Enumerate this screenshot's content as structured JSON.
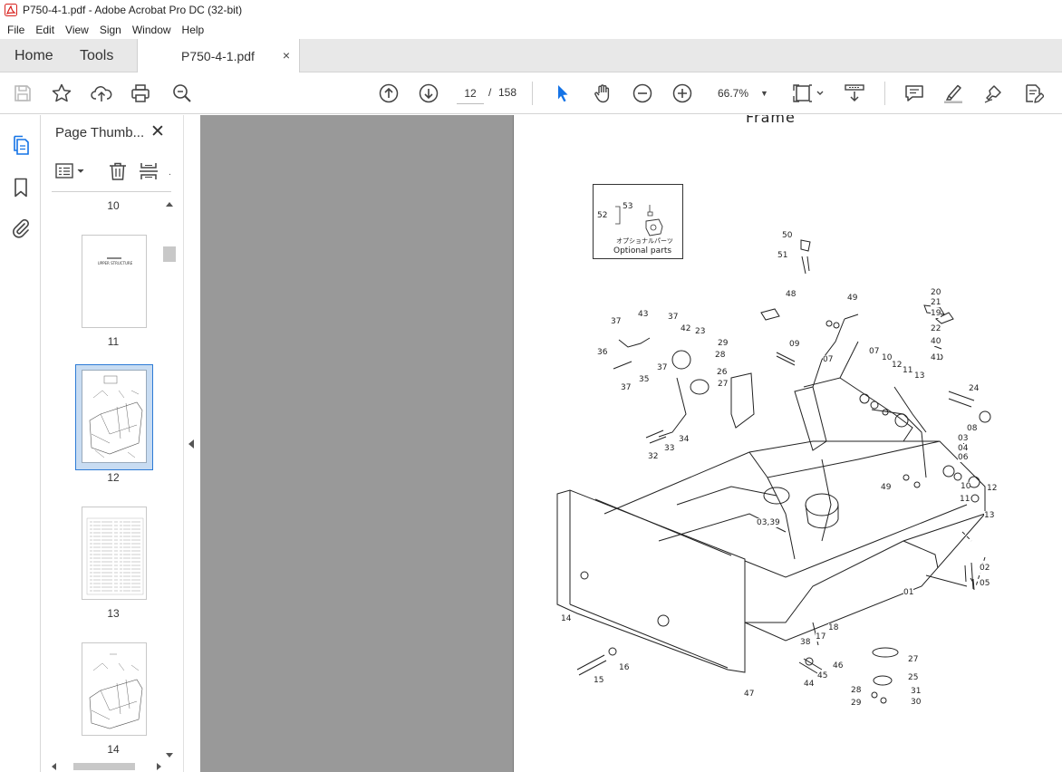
{
  "window": {
    "title": "P750-4-1.pdf - Adobe Acrobat Pro DC (32-bit)"
  },
  "menu": [
    "File",
    "Edit",
    "View",
    "Sign",
    "Window",
    "Help"
  ],
  "tabs": {
    "home": "Home",
    "tools": "Tools",
    "file": "P750-4-1.pdf",
    "close": "×"
  },
  "toolbar": {
    "page_current": "12",
    "page_sep": "/",
    "page_total": "158",
    "zoom": "66.7%",
    "icons": [
      "save-icon",
      "star-icon",
      "upload-icon",
      "print-icon",
      "zoom-search-icon",
      "prev-page-icon",
      "next-page-icon",
      "select-cursor-icon",
      "hand-icon",
      "zoom-out-icon",
      "zoom-in-icon",
      "fit-page-icon",
      "scroll-mode-icon",
      "comment-icon",
      "highlight-icon",
      "sign-icon",
      "edit-pdf-icon"
    ],
    "accent": "#1473e6"
  },
  "panel": {
    "title": "Page Thumb...",
    "close": "✕",
    "thumbnails": [
      {
        "num": "10"
      },
      {
        "num": "11",
        "text": "UPPER STRUCTURE"
      },
      {
        "num": "12",
        "selected": true
      },
      {
        "num": "13"
      },
      {
        "num": "14"
      }
    ]
  },
  "document": {
    "heading": "Frame",
    "inset_label_jp": "オプショナルパーツ",
    "inset_label_en": "Optional parts",
    "inset_numbers": [
      "53",
      "52"
    ],
    "part_numbers": [
      "50",
      "51",
      "48",
      "49",
      "09",
      "07",
      "07",
      "10",
      "12",
      "11",
      "13",
      "20",
      "21",
      "19",
      "22",
      "40",
      "41",
      "24",
      "08",
      "03",
      "04",
      "06",
      "10",
      "12",
      "11",
      "13",
      "49",
      "37",
      "43",
      "37",
      "42",
      "23",
      "29",
      "28",
      "26",
      "36",
      "35",
      "37",
      "37",
      "27",
      "32",
      "33",
      "34",
      "03,39",
      "02",
      "05",
      "01",
      "14",
      "38",
      "17",
      "18",
      "15",
      "16",
      "44",
      "45",
      "46",
      "47",
      "27",
      "25",
      "28",
      "31",
      "29",
      "30"
    ]
  }
}
